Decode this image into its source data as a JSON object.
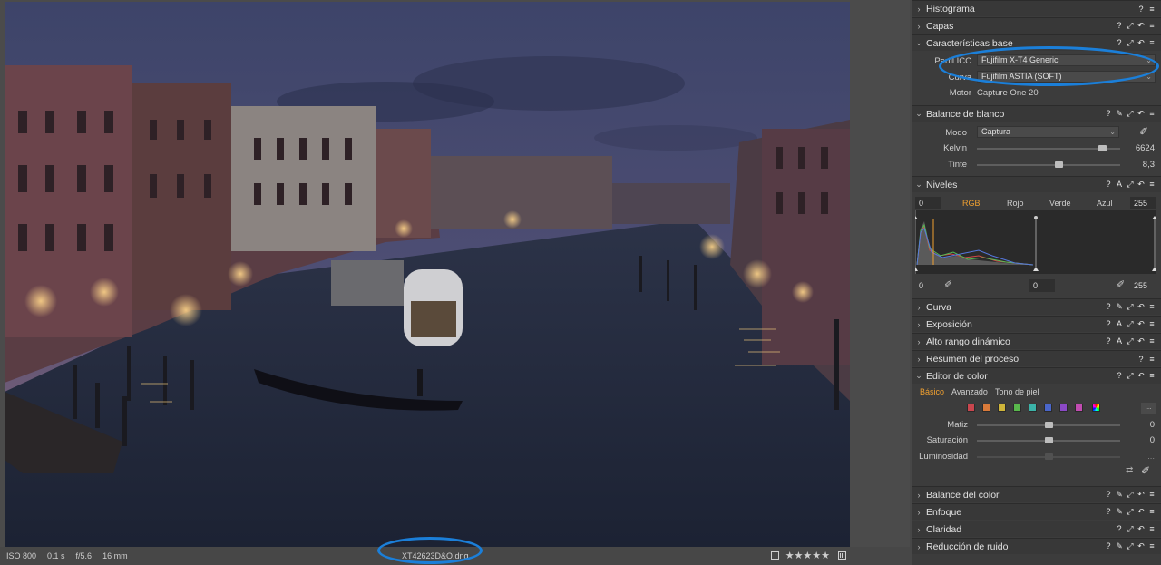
{
  "viewer": {
    "status": {
      "iso": "ISO 800",
      "shutter": "0.1 s",
      "aperture": "f/5.6",
      "focal": "16 mm",
      "filename": "_XT42623D&O.dng",
      "stars": "★★★★★"
    }
  },
  "panel": {
    "sections": {
      "histograma": "Histograma",
      "capas": "Capas",
      "caracteristicas": "Características base",
      "balance_blanco": "Balance de blanco",
      "niveles": "Niveles",
      "curva": "Curva",
      "exposicion": "Exposición",
      "alto_rango": "Alto rango dinámico",
      "resumen": "Resumen del proceso",
      "editor_color": "Editor de color",
      "balance_color": "Balance del color",
      "enfoque": "Enfoque",
      "claridad": "Claridad",
      "reduccion_ruido": "Reducción de ruido"
    },
    "base": {
      "icc_label": "Perfil ICC",
      "icc_value": "Fujifilm X-T4 Generic",
      "curve_label": "Curva",
      "curve_value": "Fujifilm ASTIA (SOFT)",
      "engine_label": "Motor",
      "engine_value": "Capture One 20"
    },
    "wb": {
      "mode_label": "Modo",
      "mode_value": "Captura",
      "kelvin_label": "Kelvin",
      "kelvin_value": "6624",
      "kelvin_pos": 0.9,
      "tint_label": "Tinte",
      "tint_value": "8,3",
      "tint_pos": 0.58
    },
    "levels": {
      "in_low": "0",
      "in_high": "255",
      "tabs": [
        "RGB",
        "Rojo",
        "Verde",
        "Azul"
      ],
      "out_low": "0",
      "mid": "0",
      "out_high": "255"
    },
    "color_editor": {
      "tabs": [
        "Básico",
        "Avanzado",
        "Tono de piel"
      ],
      "swatches": [
        "#c9464e",
        "#d97a3a",
        "#cfb53a",
        "#59b84c",
        "#3bb3a8",
        "#4a66c9",
        "#8a49c6",
        "#c24cb1"
      ],
      "more": "...",
      "hue_label": "Matiz",
      "hue_value": "0",
      "hue_pos": 0.5,
      "sat_label": "Saturación",
      "sat_value": "0",
      "sat_pos": 0.5,
      "lum_label": "Luminosidad",
      "lum_value": "...",
      "lum_pos": 0.5
    },
    "icons": [
      "help-icon",
      "auto-icon",
      "copy-icon",
      "reset-icon",
      "menu-icon"
    ]
  }
}
